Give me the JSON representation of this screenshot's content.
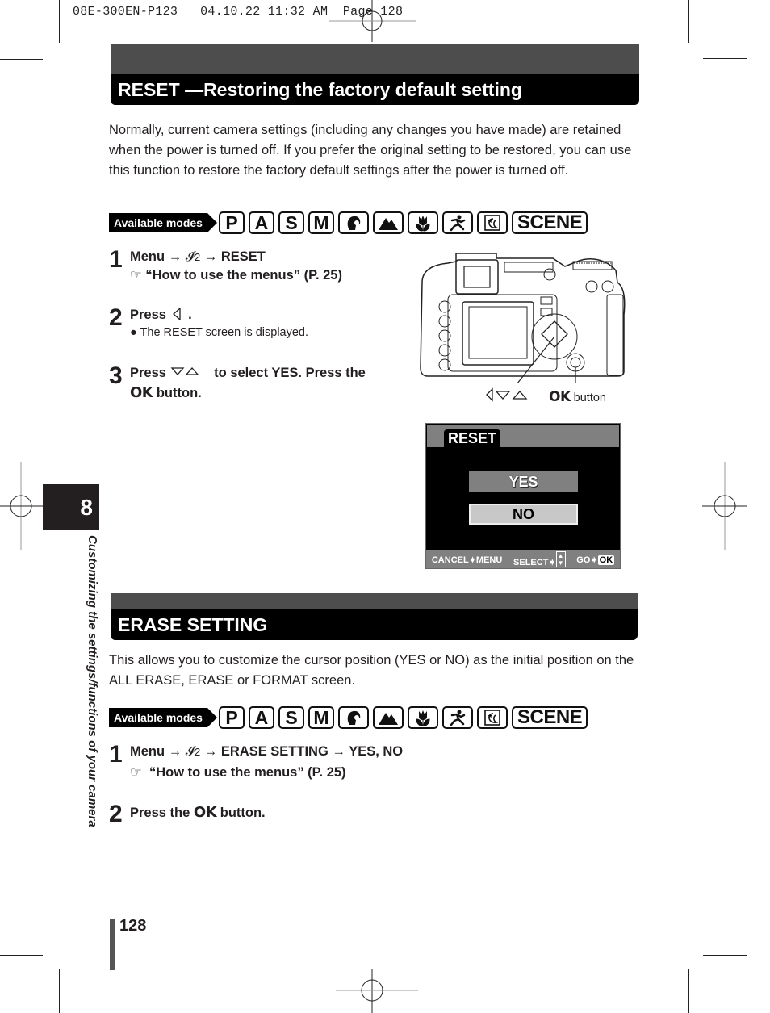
{
  "slug": "08E-300EN-P123   04.10.22 11:32 AM  Page 128",
  "chapter": {
    "number": "8",
    "side_title": "Customizing the settings/functions of your camera"
  },
  "page_number": "128",
  "available_modes": {
    "label": "Available modes",
    "modes": [
      {
        "type": "text",
        "text": "P"
      },
      {
        "type": "text",
        "text": "A"
      },
      {
        "type": "text",
        "text": "S"
      },
      {
        "type": "text",
        "text": "M"
      },
      {
        "type": "icon",
        "icon": "portrait-icon"
      },
      {
        "type": "icon",
        "icon": "landscape-icon"
      },
      {
        "type": "icon",
        "icon": "macro-icon"
      },
      {
        "type": "icon",
        "icon": "sports-icon"
      },
      {
        "type": "icon",
        "icon": "night-scene-icon"
      },
      {
        "type": "text",
        "text": "SCENE"
      }
    ]
  },
  "reset_section": {
    "title": "RESET —Restoring the factory default setting",
    "intro": "Normally, current camera settings (including any changes you have made) are retained when the power is turned off. If you prefer the original setting to be restored, you can use this function to restore the factory default settings after the power is turned off.",
    "steps": [
      {
        "number": "1",
        "line1": {
          "menu": "Menu",
          "arrow": "→",
          "tab": "2",
          "arrow2": "→",
          "item": "RESET"
        },
        "ref": "“How to use the menus” (P. 25)"
      },
      {
        "number": "2",
        "text": "Press",
        "after": ".",
        "bullet": "The RESET screen is displayed."
      },
      {
        "number": "3",
        "text_a": "Press",
        "text_b": "to select YES. Press the",
        "ok": "OK",
        "text_c": "button."
      }
    ],
    "camera_caption": {
      "ok": "OK",
      "button": "button"
    },
    "lcd_screen": {
      "title": "RESET",
      "options": [
        "YES",
        "NO"
      ],
      "selected": "NO",
      "footer": {
        "cancel": "CANCEL",
        "cancel_target": "MENU",
        "select": "SELECT",
        "go": "GO",
        "go_target": "OK"
      }
    }
  },
  "erase_section": {
    "title": "ERASE SETTING",
    "intro": "This allows you to customize the cursor position (YES or NO) as the initial position on the ALL ERASE, ERASE or FORMAT screen.",
    "steps": [
      {
        "number": "1",
        "line1": {
          "menu": "Menu",
          "arrow": "→",
          "tab": "2",
          "arrow2": "→",
          "item": "ERASE SETTING",
          "arrow3": "→",
          "value": "YES, NO"
        },
        "ref": "“How to use the menus” (P. 25)"
      },
      {
        "number": "2",
        "text_a": "Press the",
        "ok": "OK",
        "text_b": "button."
      }
    ]
  }
}
